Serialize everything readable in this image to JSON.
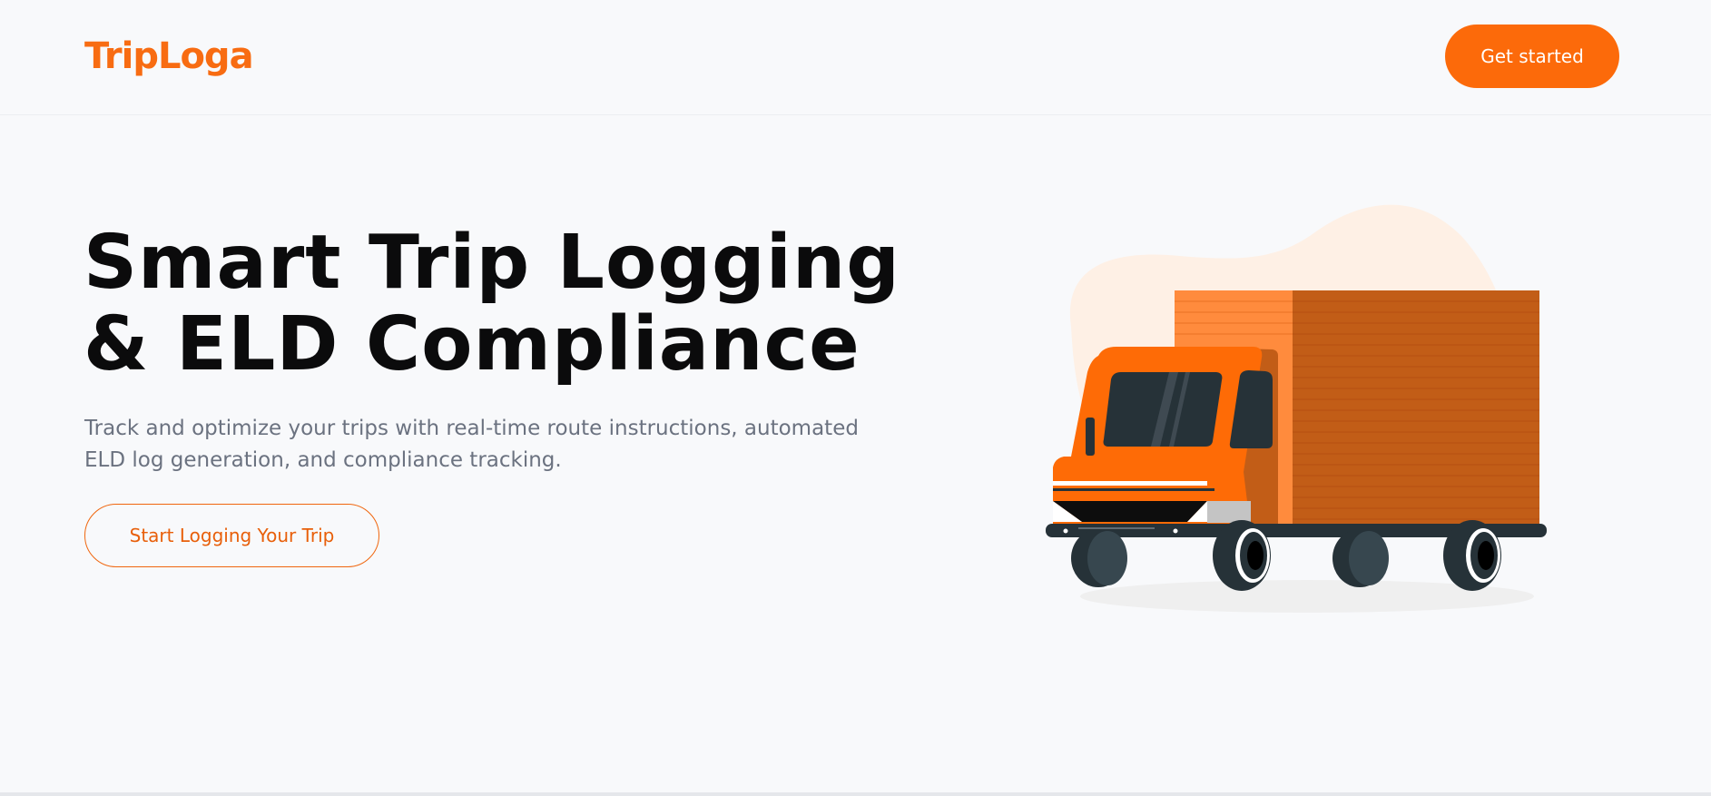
{
  "header": {
    "logo": "TripLoga",
    "cta_label": "Get started"
  },
  "hero": {
    "title_line1": "Smart Trip Logging",
    "title_line2": "& ELD Compliance",
    "subtitle_line1": "Track and optimize your trips with real-time route instructions, automated",
    "subtitle_line2": "ELD log generation, and compliance tracking.",
    "cta_label": "Start Logging Your Trip"
  },
  "colors": {
    "accent": "#fc6a0a",
    "logo": "#f86c12",
    "heading": "#0b0b0c",
    "body_text": "#6b7280",
    "background": "#f8f9fb",
    "truck_box": "#c25d17",
    "truck_cab": "#fe6b06",
    "window": "#263238"
  },
  "illustration": {
    "icon": "delivery-truck-illustration"
  }
}
